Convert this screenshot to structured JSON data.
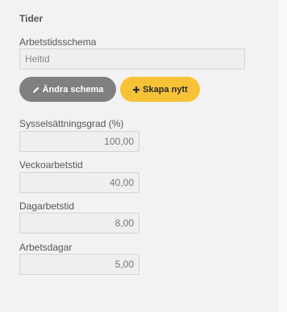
{
  "section": {
    "title": "Tider"
  },
  "schedule": {
    "label": "Arbetstidsschema",
    "value": "Heltid"
  },
  "buttons": {
    "edit_label": "Ändra schema",
    "new_label": "Skapa nytt",
    "edit_icon": "pencil-icon",
    "new_icon": "plus-icon"
  },
  "fields": [
    {
      "label": "Sysselsättningsgrad (%)",
      "value": "100,00"
    },
    {
      "label": "Veckoarbetstid",
      "value": "40,00"
    },
    {
      "label": "Dagarbetstid",
      "value": "8,00"
    },
    {
      "label": "Arbetsdagar",
      "value": "5,00"
    }
  ],
  "colors": {
    "background": "#f2f2f2",
    "edit_button": "#808080",
    "new_button": "#f7c236"
  }
}
